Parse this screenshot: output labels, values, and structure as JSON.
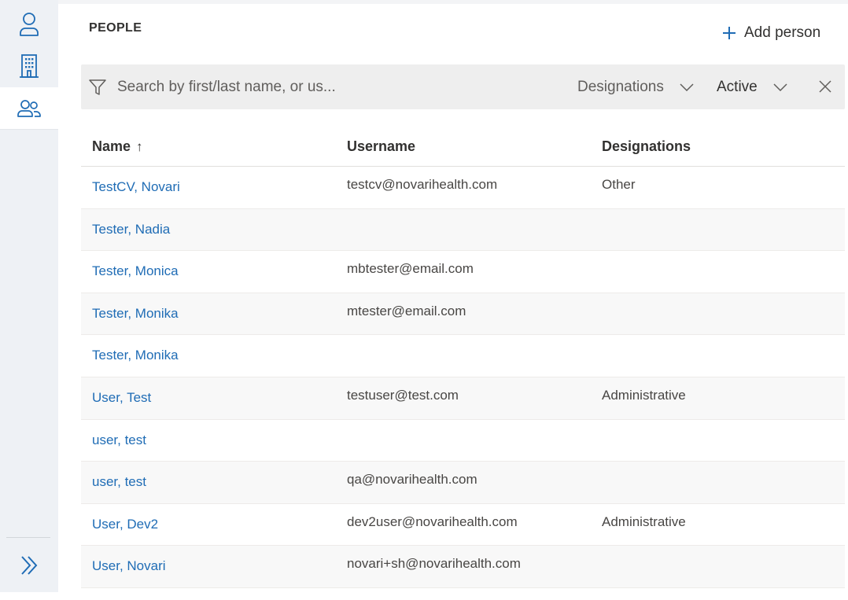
{
  "nav": {
    "items": [
      {
        "name": "person",
        "icon": "person-icon",
        "active": false
      },
      {
        "name": "building",
        "icon": "building-icon",
        "active": false
      },
      {
        "name": "people",
        "icon": "people-icon",
        "active": true
      }
    ],
    "expand_icon": "double-chevron-right-icon"
  },
  "header": {
    "title": "PEOPLE",
    "add_person_label": "Add person"
  },
  "filters": {
    "search_placeholder": "Search by first/last name, or us...",
    "search_value": "",
    "designations_label": "Designations",
    "status_label": "Active"
  },
  "table": {
    "columns": {
      "name": "Name",
      "name_sort": "↑",
      "username": "Username",
      "designations": "Designations"
    },
    "rows": [
      {
        "name": "TestCV, Novari",
        "username": "testcv@novarihealth.com",
        "designations": "Other"
      },
      {
        "name": "Tester, Nadia",
        "username": "",
        "designations": ""
      },
      {
        "name": "Tester, Monica",
        "username": "mbtester@email.com",
        "designations": ""
      },
      {
        "name": "Tester, Monika",
        "username": "mtester@email.com",
        "designations": ""
      },
      {
        "name": "Tester, Monika",
        "username": "",
        "designations": ""
      },
      {
        "name": "User, Test",
        "username": "testuser@test.com",
        "designations": "Administrative"
      },
      {
        "name": "user, test",
        "username": "",
        "designations": ""
      },
      {
        "name": "user, test",
        "username": "qa@novarihealth.com",
        "designations": ""
      },
      {
        "name": "User, Dev2",
        "username": "dev2user@novarihealth.com",
        "designations": "Administrative"
      },
      {
        "name": "User, Novari",
        "username": "novari+sh@novarihealth.com",
        "designations": ""
      }
    ]
  },
  "colors": {
    "accent": "#1f6cb5",
    "rail_bg": "#eef1f5",
    "filter_bg": "#eeeeee",
    "text": "#323130"
  }
}
